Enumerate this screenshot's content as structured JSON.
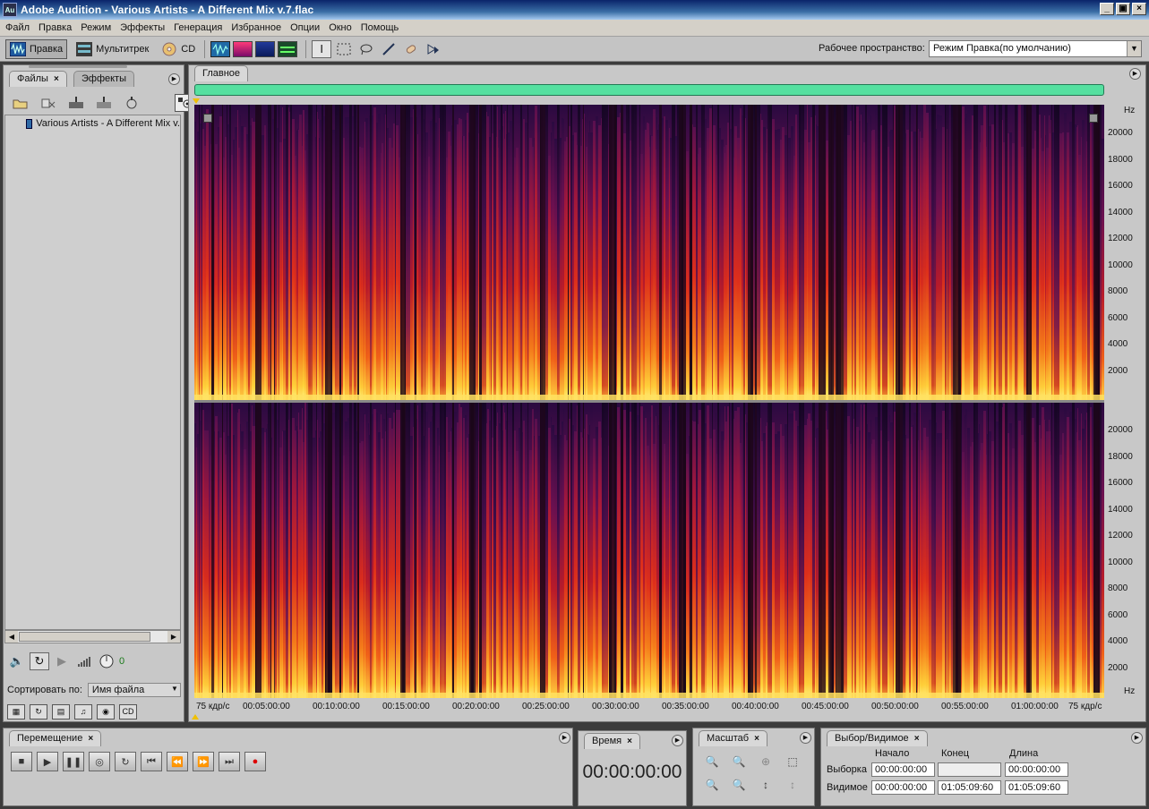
{
  "window": {
    "title": "Adobe Audition - Various Artists - A Different Mix v.7.flac",
    "icon": "Au",
    "controls": [
      "_",
      "▣",
      "×"
    ]
  },
  "menu": [
    "Файл",
    "Правка",
    "Режим",
    "Эффекты",
    "Генерация",
    "Избранное",
    "Опции",
    "Окно",
    "Помощь"
  ],
  "toolbar": {
    "edit_label": "Правка",
    "multitrack_label": "Мультитрек",
    "cd_label": "CD",
    "workspace_label": "Рабочее пространство:",
    "workspace_value": "Режим Правка(по умолчанию)"
  },
  "files_panel": {
    "tab_files": "Файлы",
    "tab_effects": "Эффекты",
    "close": "×",
    "items": [
      {
        "name": "Various Artists - A Different Mix v."
      }
    ],
    "volume_value": "0",
    "sort_label": "Сортировать по:",
    "sort_value": "Имя файла"
  },
  "editor": {
    "tab": "Главное",
    "freq_labels": [
      "Hz",
      "20000",
      "18000",
      "16000",
      "14000",
      "12000",
      "10000",
      "8000",
      "6000",
      "4000",
      "2000",
      "20000",
      "18000",
      "16000",
      "14000",
      "12000",
      "10000",
      "8000",
      "6000",
      "4000",
      "2000",
      "Hz"
    ],
    "time_labels": [
      "75 кдр/с",
      "00:05:00:00",
      "00:10:00:00",
      "00:15:00:00",
      "00:20:00:00",
      "00:25:00:00",
      "00:30:00:00",
      "00:35:00:00",
      "00:40:00:00",
      "00:45:00:00",
      "00:50:00:00",
      "00:55:00:00",
      "01:00:00:00",
      "75 кдр/с"
    ]
  },
  "transport": {
    "tab": "Перемещение",
    "close": "×",
    "buttons": [
      "■",
      "▶",
      "❚❚",
      "◎",
      "↻",
      "⏮",
      "⏪",
      "⏩",
      "⏭",
      "●"
    ]
  },
  "time_panel": {
    "tab": "Время",
    "close": "×",
    "value": "00:00:00:00"
  },
  "zoom_panel": {
    "tab": "Масштаб",
    "close": "×"
  },
  "selection_panel": {
    "tab": "Выбор/Видимое",
    "close": "×",
    "col_start": "Начало",
    "col_end": "Конец",
    "col_length": "Длина",
    "row_selection": "Выборка",
    "row_view": "Видимое",
    "sel_start": "00:00:00:00",
    "sel_end": "",
    "sel_length": "00:00:00:00",
    "view_start": "00:00:00:00",
    "view_end": "01:05:09:60",
    "view_length": "01:05:09:60"
  },
  "colors": {
    "accent": "#55e0a0",
    "spectrogram_hot": "#ffd24a",
    "spectrogram_mid": "#d0201a",
    "spectrogram_cold": "#2a0a3a"
  }
}
